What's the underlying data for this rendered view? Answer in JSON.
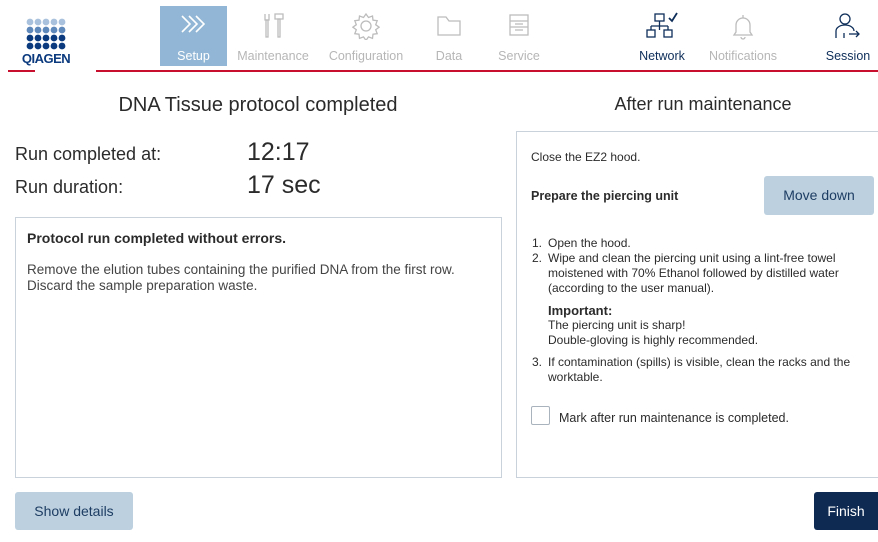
{
  "brand": {
    "logo_text": "QIAGEN",
    "red": "#c8102e",
    "navy": "#0b3a7e",
    "dot_colors": [
      "#a9c1dc",
      "#5f88bb",
      "#0b3a7e"
    ]
  },
  "nav": {
    "setup": {
      "label": "Setup",
      "icon": "chevrons-icon",
      "active": true
    },
    "maintenance": {
      "label": "Maintenance",
      "icon": "tools-icon"
    },
    "configuration": {
      "label": "Configuration",
      "icon": "gear-icon"
    },
    "data": {
      "label": "Data",
      "icon": "folder-icon"
    },
    "service": {
      "label": "Service",
      "icon": "service-icon"
    },
    "network": {
      "label": "Network",
      "icon": "network-connected-icon"
    },
    "notifications": {
      "label": "Notifications",
      "icon": "bell-icon"
    },
    "session": {
      "label": "Session",
      "icon": "user-logout-icon"
    }
  },
  "left": {
    "heading": "DNA Tissue protocol completed",
    "run_completed_label": "Run completed at:",
    "run_completed_value": "12:17",
    "run_duration_label": "Run duration:",
    "run_duration_value": "17 sec",
    "message_title": "Protocol run completed without errors.",
    "message_body": "Remove the elution tubes containing the purified DNA from the first row. Discard the sample preparation waste.",
    "show_details_label": "Show details"
  },
  "right": {
    "heading": "After run maintenance",
    "close_hood": "Close the EZ2 hood.",
    "prepare_label": "Prepare the piercing unit",
    "move_down_label": "Move down",
    "steps": [
      {
        "num": "1.",
        "text": "Open the hood."
      },
      {
        "num": "2.",
        "text": "Wipe and clean the piercing unit using a lint-free towel moistened with 70% Ethanol followed by distilled water (according to the user manual)."
      },
      {
        "num": "3.",
        "text": "If contamination (spills) is visible, clean the racks and the worktable."
      }
    ],
    "important_title": "Important:",
    "important_line1": "The piercing unit is sharp!",
    "important_line2": "Double-gloving is highly recommended.",
    "checkbox_label": "Mark after run maintenance is completed.",
    "checkbox_checked": false,
    "finish_label": "Finish"
  }
}
